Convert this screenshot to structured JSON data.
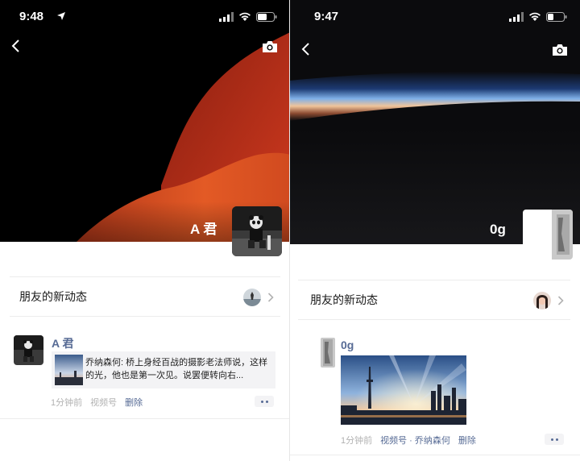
{
  "left": {
    "status": {
      "time": "9:48"
    },
    "profile": {
      "name": "A 君"
    },
    "friends": {
      "label": "朋友的新动态"
    },
    "post": {
      "author": "A 君",
      "share_text": "乔纳森何: 桥上身经百战的摄影老法师说，这样的光，他也是第一次见。说罢便转向右...",
      "time_ago": "1分钟前",
      "source": "视频号",
      "delete_label": "删除"
    }
  },
  "right": {
    "status": {
      "time": "9:47"
    },
    "profile": {
      "name": "0g"
    },
    "friends": {
      "label": "朋友的新动态"
    },
    "post": {
      "author": "0g",
      "time_ago": "1分钟前",
      "source": "视频号 · 乔纳森何",
      "delete_label": "删除"
    }
  },
  "colors": {
    "link_blue": "#576b95",
    "meta_gray": "#b2b2b2",
    "card_bg": "#f3f3f5",
    "cover_red": "#c4321e",
    "cover_orange": "#e05a24"
  },
  "icons": {
    "back": "chevron-left-icon",
    "camera": "camera-icon",
    "chevron": "chevron-right-icon",
    "signal": "signal-icon",
    "wifi": "wifi-icon",
    "battery": "battery-icon",
    "location": "location-arrow-icon"
  }
}
